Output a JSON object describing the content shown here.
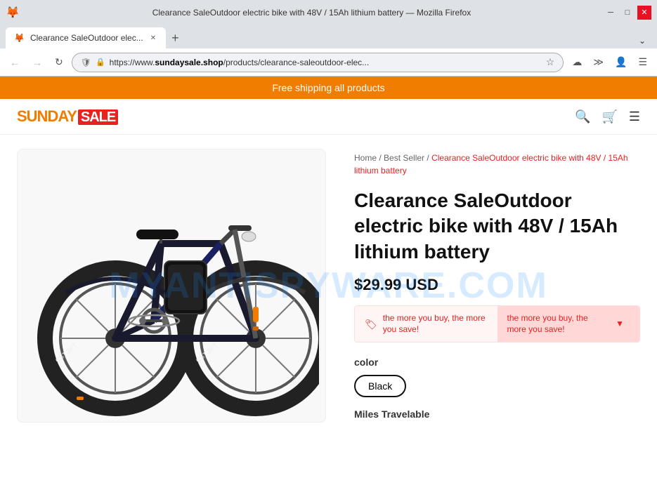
{
  "browser": {
    "title": "Clearance SaleOutdoor electric bike with 48V / 15Ah lithium battery — Mozilla Firefox",
    "tab_title": "Clearance SaleOutdoor elec...",
    "url_display": "https://www.sundaysale.shop/products/clearance-saleoutdoor-elec...",
    "url_brand": "sundaysale.shop",
    "url_path": "/products/clearance-saleoutdoor-elec...",
    "nav": {
      "back_disabled": true,
      "forward_disabled": true
    }
  },
  "promo_banner": {
    "text": "Free shipping all products"
  },
  "header": {
    "logo_sunday": "SUNDAY",
    "logo_sale": "SALE"
  },
  "breadcrumb": {
    "home": "Home",
    "separator1": "/",
    "best_seller": "Best Seller",
    "separator2": "/",
    "current": "Clearance SaleOutdoor electric bike with 48V / 15Ah lithium battery"
  },
  "product": {
    "title": "Clearance SaleOutdoor electric bike with 48V / 15Ah lithium battery",
    "price": "$29.99 USD",
    "discount_text1": "the more you buy, the more you save!",
    "discount_text2": "the more you buy, the more you save!",
    "color_label": "color",
    "color_options": [
      {
        "label": "Black",
        "selected": true
      }
    ],
    "miles_label": "Miles Travelable"
  },
  "watermark": "MYANTISPYWARE.COM"
}
